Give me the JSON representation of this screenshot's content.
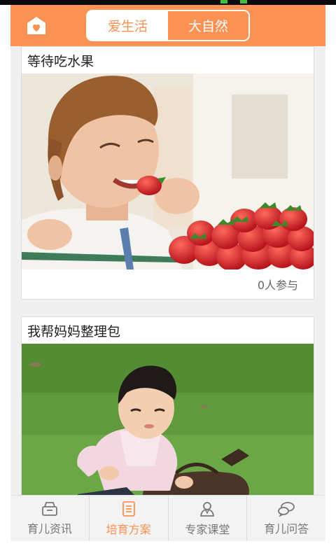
{
  "header": {
    "home_icon": "home-heart-icon",
    "tabs": [
      "爱生活",
      "大自然"
    ],
    "active_tab": 1,
    "accent": "#fb9152"
  },
  "feed": {
    "cards": [
      {
        "title": "等待吃水果",
        "participants": "0人参与"
      },
      {
        "title": "我帮妈妈整理包"
      }
    ]
  },
  "tabbar": {
    "items": [
      {
        "label": "育儿资讯",
        "icon": "news-box-icon"
      },
      {
        "label": "培育方案",
        "icon": "document-list-icon"
      },
      {
        "label": "专家课堂",
        "icon": "expert-person-icon"
      },
      {
        "label": "育儿问答",
        "icon": "chat-bubbles-icon"
      }
    ],
    "active": 1
  }
}
